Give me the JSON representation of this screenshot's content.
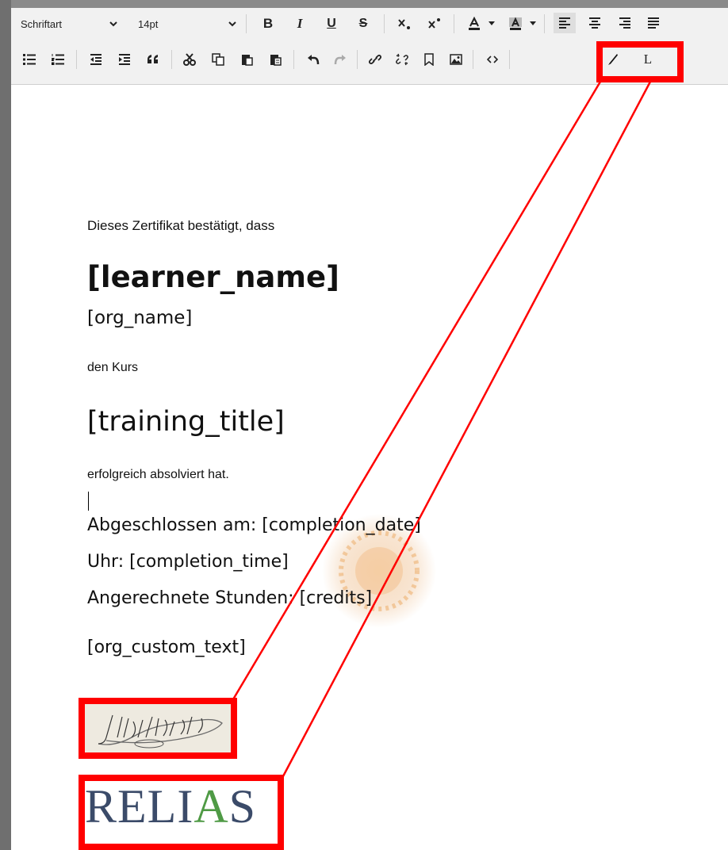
{
  "toolbar": {
    "font_label": "Schriftart",
    "font_size": "14pt",
    "bold": "B",
    "italic": "I",
    "underline": "U",
    "strike": "S",
    "insert_letter": "L"
  },
  "document": {
    "intro": "Dieses Zertifikat bestätigt, dass",
    "learner": "[learner_name]",
    "org": "[org_name]",
    "course_label": "den Kurs",
    "title": "[training_title]",
    "completed": "erfolgreich absolviert hat.",
    "date_line": "Abgeschlossen am: [completion_date]",
    "time_line": "Uhr: [completion_time]",
    "credits_line": "Angerechnete Stunden: [credits]",
    "custom": "[org_custom_text]",
    "signature_text": "John Hancock",
    "logo_parts": [
      "RELI",
      "A",
      "S"
    ]
  },
  "colors": {
    "highlight": "#ff0000",
    "logo_blue": "#3b4b69",
    "logo_green": "#4f9a45",
    "stamp": "#e8a050"
  }
}
